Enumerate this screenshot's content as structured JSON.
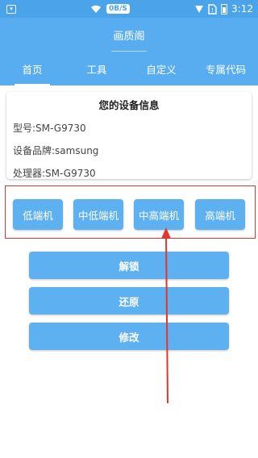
{
  "status_bar": {
    "network_speed": "0B/S",
    "time": "3:12"
  },
  "header": {
    "title": "画质阁"
  },
  "tabs": [
    {
      "label": "首页",
      "active": true
    },
    {
      "label": "工具",
      "active": false
    },
    {
      "label": "自定义",
      "active": false
    },
    {
      "label": "专属代码",
      "active": false
    }
  ],
  "device_info": {
    "title": "您的设备信息",
    "model": "型号:SM-G9730",
    "brand": "设备品牌:samsung",
    "processor": "处理器:SM-G9730"
  },
  "tiers": [
    "低端机",
    "中低端机",
    "中高端机",
    "高端机"
  ],
  "actions": {
    "unlock": "解锁",
    "restore": "还原",
    "modify": "修改"
  },
  "colors": {
    "primary": "#57adef",
    "button": "#5eb1f1",
    "highlight": "#e0362b"
  }
}
